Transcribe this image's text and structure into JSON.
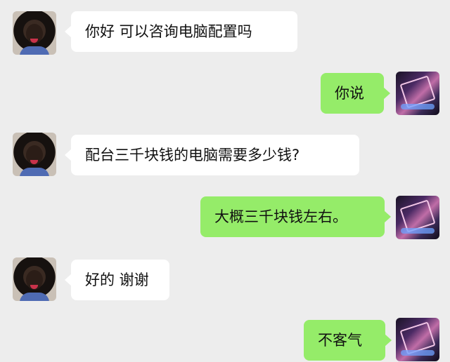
{
  "messages": [
    {
      "side": "left",
      "text": "你好 可以咨询电脑配置吗"
    },
    {
      "side": "right",
      "text": "你说"
    },
    {
      "side": "left",
      "text": "配台三千块钱的电脑需要多少钱?"
    },
    {
      "side": "right",
      "text": "大概三千块钱左右。"
    },
    {
      "side": "left",
      "text": "好的 谢谢"
    },
    {
      "side": "right",
      "text": "不客气"
    }
  ]
}
